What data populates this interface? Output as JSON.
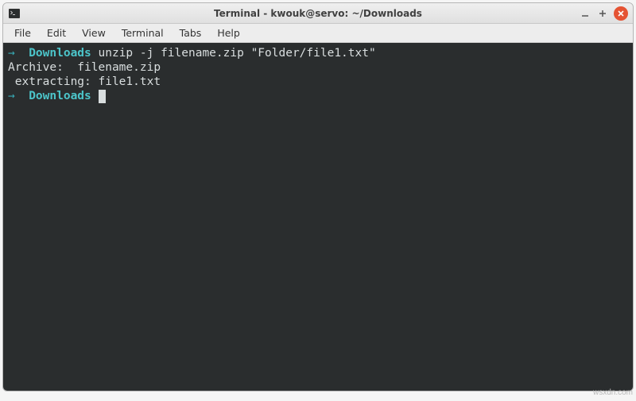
{
  "window": {
    "title": "Terminal - kwouk@servo: ~/Downloads"
  },
  "menubar": {
    "file": "File",
    "edit": "Edit",
    "view": "View",
    "terminal": "Terminal",
    "tabs": "Tabs",
    "help": "Help"
  },
  "terminal": {
    "line1": {
      "arrow": "→  ",
      "dir": "Downloads",
      "cmd": " unzip -j filename.zip \"Folder/file1.txt\""
    },
    "line2": "Archive:  filename.zip",
    "line3": " extracting: file1.txt",
    "line4": {
      "arrow": "→  ",
      "dir": "Downloads",
      "tail": " "
    }
  },
  "watermark": "wsxdn.com"
}
